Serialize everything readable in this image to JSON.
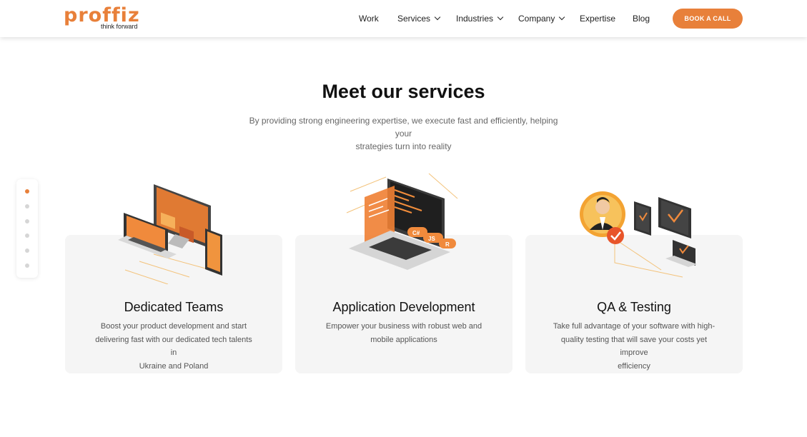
{
  "header": {
    "logo": {
      "word": "proffiz",
      "tagline": "think forward"
    },
    "nav": [
      {
        "label": "Work",
        "dropdown": false
      },
      {
        "label": "Services",
        "dropdown": true
      },
      {
        "label": "Industries",
        "dropdown": true
      },
      {
        "label": "Company",
        "dropdown": true
      },
      {
        "label": "Expertise",
        "dropdown": false
      },
      {
        "label": "Blog",
        "dropdown": false
      }
    ],
    "cta_label": "BOOK A CALL"
  },
  "hero": {
    "title": "Meet our services",
    "subtitle_line1": "By providing strong engineering expertise, we execute fast and efficiently, helping your",
    "subtitle_line2": "strategies turn into reality"
  },
  "pager": {
    "total": 6,
    "active_index": 0
  },
  "services": [
    {
      "title": "Dedicated Teams",
      "desc_lines": [
        "Boost your product development and start",
        "delivering fast with our dedicated tech talents in",
        "Ukraine and Poland"
      ],
      "icon": "devices-video-call-icon"
    },
    {
      "title": "Application Development",
      "desc_lines": [
        "Empower your business with robust web and",
        "mobile applications"
      ],
      "icon": "laptop-code-icon",
      "badges": [
        "C#",
        "JS",
        "R"
      ]
    },
    {
      "title": "QA & Testing",
      "desc_lines": [
        "Take full advantage of your software with high-",
        "quality testing that will save your costs yet improve",
        "efficiency"
      ],
      "icon": "qa-testing-icon"
    }
  ],
  "colors": {
    "accent": "#e8803a",
    "card_bg": "#f5f5f5",
    "text_dark": "#111111",
    "text_muted": "#555555"
  }
}
